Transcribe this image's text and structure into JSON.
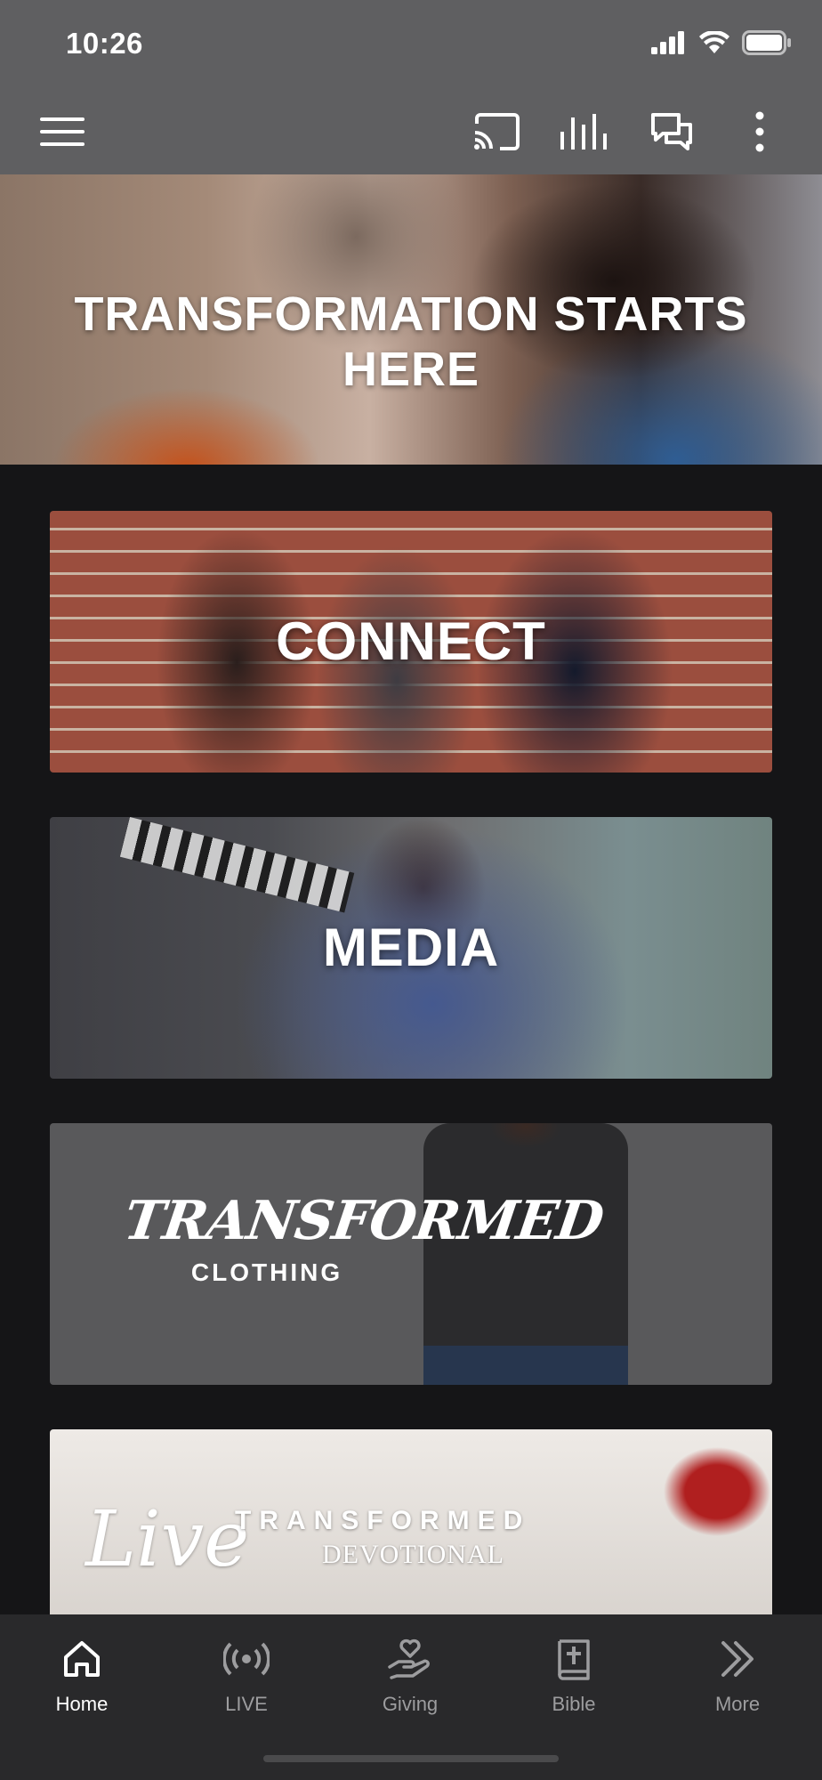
{
  "status_bar": {
    "time": "10:26"
  },
  "toolbar": {
    "icons": [
      "menu-icon",
      "cast-icon",
      "equalizer-icon",
      "chat-icon",
      "more-vert-icon"
    ]
  },
  "hero": {
    "title": "TRANSFORMATION STARTS HERE"
  },
  "cards": {
    "connect": "CONNECT",
    "media": "MEDIA",
    "clothing": {
      "brand": "TRANSFORMED",
      "sub": "CLOTHING"
    },
    "devotional": {
      "script": "Live",
      "title": "TRANSFORMED",
      "sub": "DEVOTIONAL"
    }
  },
  "tabs": [
    {
      "label": "Home",
      "icon": "home-icon",
      "active": true
    },
    {
      "label": "LIVE",
      "icon": "broadcast-icon",
      "active": false
    },
    {
      "label": "Giving",
      "icon": "giving-hand-heart-icon",
      "active": false
    },
    {
      "label": "Bible",
      "icon": "bible-icon",
      "active": false
    },
    {
      "label": "More",
      "icon": "chevrons-right-icon",
      "active": false
    }
  ],
  "colors": {
    "bars": "#5f5f61",
    "background": "#151517",
    "tabbar": "#29292b",
    "inactive_tab": "#9d9d9f"
  }
}
